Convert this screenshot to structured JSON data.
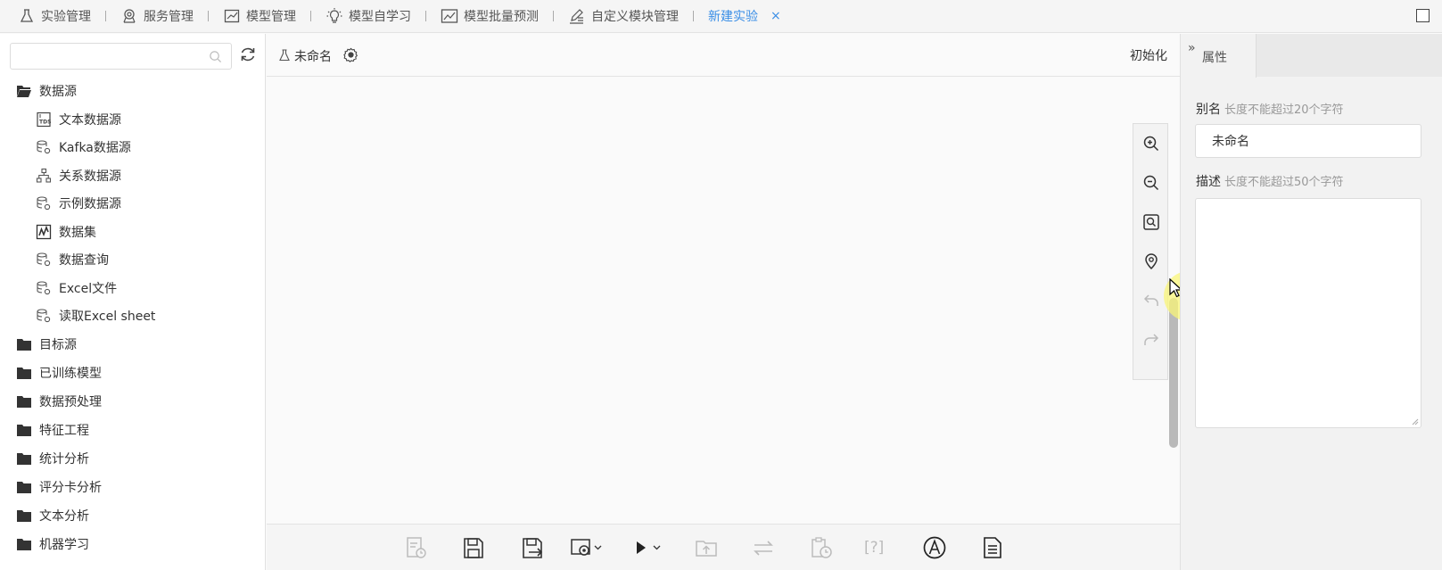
{
  "topbar": {
    "tabs": [
      {
        "label": "实验管理",
        "icon": "flask-icon"
      },
      {
        "label": "服务管理",
        "icon": "service-icon"
      },
      {
        "label": "模型管理",
        "icon": "model-chart-icon"
      },
      {
        "label": "模型自学习",
        "icon": "lightbulb-icon"
      },
      {
        "label": "模型批量预测",
        "icon": "line-chart-icon"
      },
      {
        "label": "自定义模块管理",
        "icon": "edit-icon"
      }
    ],
    "active_tab": "新建实验",
    "close_glyph": "×",
    "active_color": "#3a8ee6"
  },
  "sidebar": {
    "search_placeholder": "",
    "tree": [
      {
        "label": "数据源",
        "expanded": true,
        "children": [
          {
            "label": "文本数据源",
            "icon": "tds-icon"
          },
          {
            "label": "Kafka数据源",
            "icon": "database-icon"
          },
          {
            "label": "关系数据源",
            "icon": "relation-icon"
          },
          {
            "label": "示例数据源",
            "icon": "database-icon"
          },
          {
            "label": "数据集",
            "icon": "dataset-icon"
          },
          {
            "label": "数据查询",
            "icon": "database-icon"
          },
          {
            "label": "Excel文件",
            "icon": "database-icon"
          },
          {
            "label": "读取Excel sheet",
            "icon": "database-icon"
          }
        ]
      },
      {
        "label": "目标源"
      },
      {
        "label": "已训练模型"
      },
      {
        "label": "数据预处理"
      },
      {
        "label": "特征工程"
      },
      {
        "label": "统计分析"
      },
      {
        "label": "评分卡分析"
      },
      {
        "label": "文本分析"
      },
      {
        "label": "机器学习"
      }
    ]
  },
  "experiment": {
    "name": "未命名",
    "init_label": "初始化"
  },
  "canvas_tools": [
    "zoom-in-icon",
    "zoom-out-icon",
    "fit-view-icon",
    "locate-icon",
    "undo-icon",
    "redo-icon"
  ],
  "bottom_tools": [
    "history-icon",
    "save-icon",
    "save-as-icon",
    "settings-dropdown-icon",
    "run-dropdown-icon",
    "upload-icon",
    "swap-icon",
    "schedule-icon",
    "help-bracket-icon",
    "auto-icon",
    "document-icon"
  ],
  "help_text": "[?]",
  "properties": {
    "tab_label": "属性",
    "collapse_glyph": "»",
    "alias_label": "别名",
    "alias_hint": "长度不能超过20个字符",
    "alias_value": "未命名",
    "desc_label": "描述",
    "desc_hint": "长度不能超过50个字符",
    "desc_value": ""
  }
}
